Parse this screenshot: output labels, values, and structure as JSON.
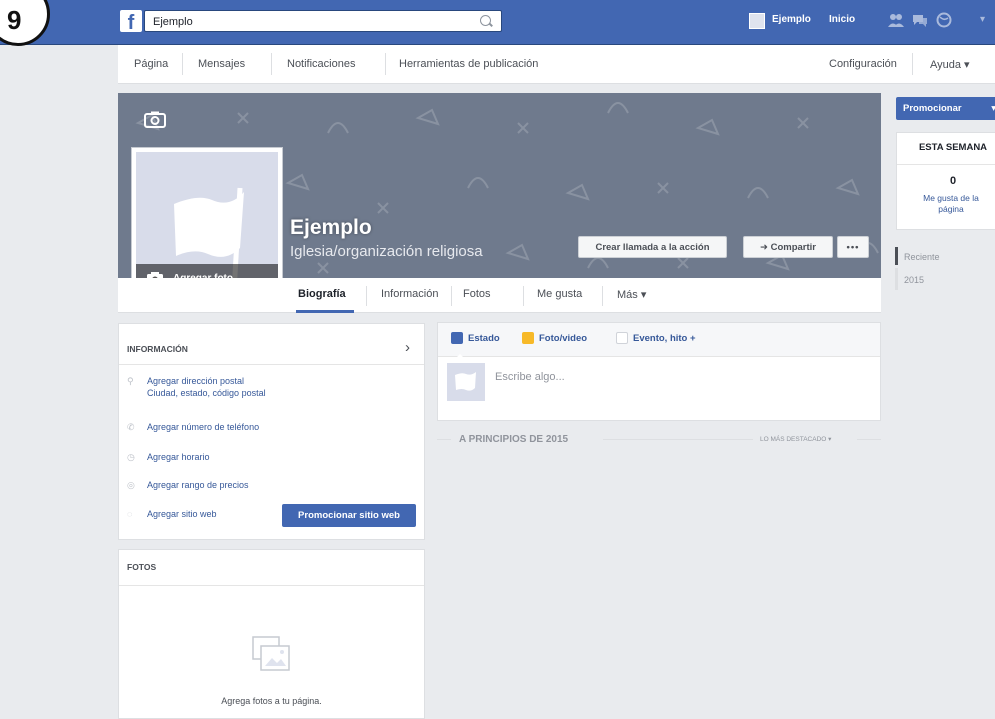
{
  "step_badge": "9",
  "topbar": {
    "logo": "f",
    "search_value": "Ejemplo",
    "user_name": "Ejemplo",
    "home_label": "Inicio",
    "icons": [
      "friends-icon",
      "messages-icon",
      "notifications-globe-icon"
    ]
  },
  "pagenav": {
    "items": [
      "Página",
      "Mensajes",
      "Notificaciones",
      "Herramientas de publicación"
    ],
    "right_items": [
      "Configuración",
      "Ayuda ▾"
    ]
  },
  "cover": {
    "page_name": "Ejemplo",
    "category": "Iglesia/organización religiosa",
    "add_photo_label": "Agregar foto",
    "cta_label": "Crear llamada a la acción",
    "share_label": "➜ Compartir",
    "more_label": "•••"
  },
  "tabs": [
    "Biografía",
    "Información",
    "Fotos",
    "Me gusta",
    "Más ▾"
  ],
  "sidebar_right": {
    "promote_label": "Promocionar",
    "week_title": "ESTA SEMANA",
    "likes_count": "0",
    "likes_label": "Me gusta de la página",
    "recent_label": "Reciente",
    "year_label": "2015"
  },
  "info_card": {
    "title": "INFORMACIÓN",
    "chevron": "›",
    "rows": [
      {
        "icon": "location-pin-icon",
        "line1": "Agregar dirección postal",
        "line2": "Ciudad, estado, código postal"
      },
      {
        "icon": "phone-icon",
        "line1": "Agregar número de teléfono"
      },
      {
        "icon": "clock-icon",
        "line1": "Agregar horario"
      },
      {
        "icon": "price-icon",
        "line1": "Agregar rango de precios"
      },
      {
        "icon": "globe-icon",
        "line1": "Agregar sitio web"
      }
    ],
    "promote_website_label": "Promocionar sitio web"
  },
  "photos_card": {
    "title": "FOTOS",
    "hint": "Agrega fotos a tu página."
  },
  "composer": {
    "tab_status": "Estado",
    "tab_photo": "Foto/video",
    "tab_event": "Evento, hito +",
    "placeholder": "Escribe algo..."
  },
  "timeline": {
    "heading": "A PRINCIPIOS DE 2015",
    "highlights": "LO MÁS DESTACADO ▾"
  },
  "colors": {
    "fb_blue": "#4267b2",
    "link_blue": "#365899",
    "background": "#e9ebee"
  }
}
